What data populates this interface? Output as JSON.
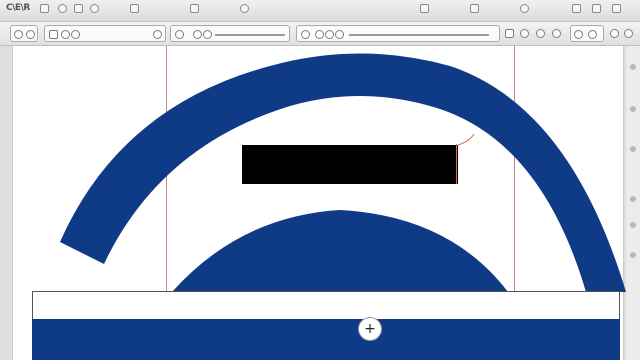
{
  "app": {
    "logo_text": "C\\E\\R"
  },
  "colors": {
    "arch_fill": "#0f3a85",
    "bar_fill": "#000000",
    "guide_line": "#c98a7e",
    "selection_edge": "#e06a3a"
  },
  "canvas": {
    "move_handle_glyph": "+"
  }
}
